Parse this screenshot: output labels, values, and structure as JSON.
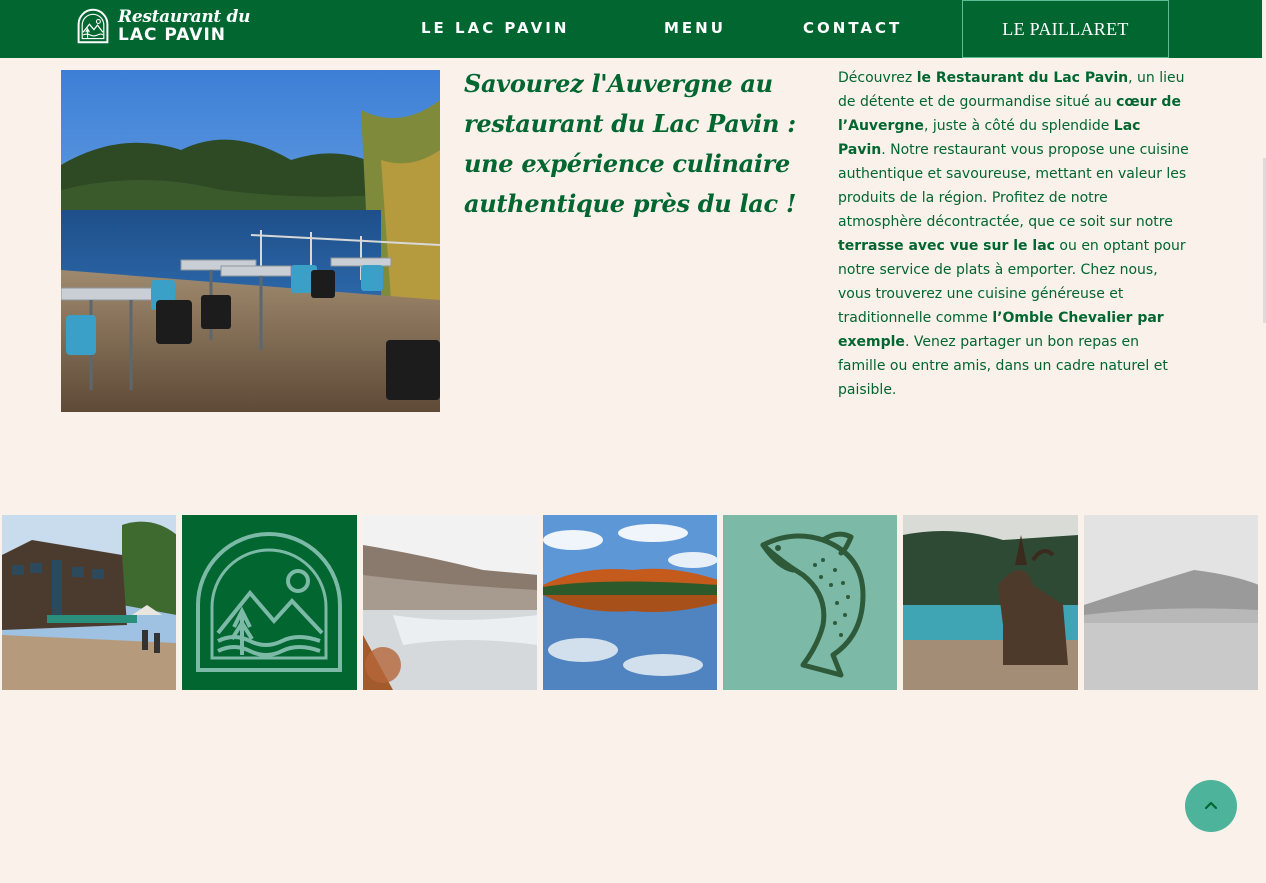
{
  "brand": {
    "logo_line1": "Restaurant du",
    "logo_line2": "LAC PAVIN"
  },
  "nav": {
    "items": [
      "LE LAC PAVIN",
      "MENU",
      "CONTACT"
    ],
    "cta_label": "LE PAILLARET"
  },
  "hero": {
    "headline": "Savourez l'Auvergne au restaurant du Lac Pavin : une expérience culinaire authentique près du lac !",
    "intro": [
      {
        "text": "Découvrez ",
        "bold": false
      },
      {
        "text": "le Restaurant du Lac Pavin",
        "bold": true
      },
      {
        "text": ", un lieu de détente et de gourmandise situé au ",
        "bold": false
      },
      {
        "text": "cœur de l’Auvergne",
        "bold": true
      },
      {
        "text": ", juste à côté du splendide ",
        "bold": false
      },
      {
        "text": "Lac Pavin",
        "bold": true
      },
      {
        "text": ". Notre restaurant vous propose une cuisine authentique et savoureuse, mettant en valeur les produits de la région. Profitez de notre atmosphère décontractée, que ce soit sur notre ",
        "bold": false
      },
      {
        "text": "terrasse avec vue sur le lac",
        "bold": true
      },
      {
        "text": " ou en optant pour notre service de plats à emporter. Chez nous, vous trouverez une cuisine généreuse et traditionnelle comme ",
        "bold": false
      },
      {
        "text": "l’Omble Chevalier par exemple",
        "bold": true
      },
      {
        "text": ". Venez partager un bon repas en famille ou entre amis, dans un cadre naturel et paisible.",
        "bold": false
      }
    ]
  },
  "colors": {
    "brand_green": "#016630",
    "background": "#faf1eb",
    "accent_teal": "#4db39a",
    "tile_teal": "#7cb9a7"
  },
  "icons": {
    "scroll_top": "chevron-up-icon",
    "logo_badge": "mountain-badge-icon",
    "fish": "fish-icon"
  }
}
